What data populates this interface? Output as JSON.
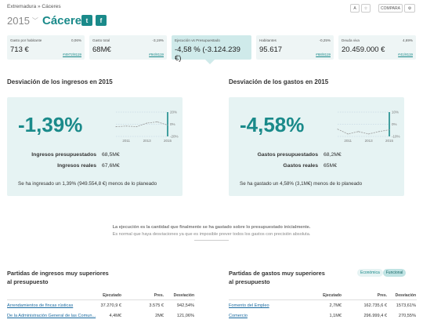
{
  "header": {
    "breadcrumb": "Extremadura » Cáceres",
    "year": "2015",
    "town": "Cáceres",
    "share_twitter": "t",
    "share_facebook": "f",
    "tool_text": "A",
    "tool_star": "☆",
    "compare_label": "COMPARA",
    "settings_icon": "⚙"
  },
  "kpis": [
    {
      "label": "Gasto por habitante",
      "pct": "0,06%",
      "value": "713 €",
      "rank": "#4972/8119"
    },
    {
      "label": "Gasto total",
      "pct": "-3,19%",
      "value": "68M€",
      "rank": "#94/8119"
    },
    {
      "label": "Ejecución vs Presupuestado",
      "pct": "",
      "value": "-4,58 % (-3.124.239 €)",
      "rank": ""
    },
    {
      "label": "Habitantes",
      "pct": "-0,25%",
      "value": "95.617",
      "rank": "#68/8119"
    },
    {
      "label": "Deuda viva",
      "pct": "4,69%",
      "value": "20.459.000 €",
      "rank": "#41/8119"
    }
  ],
  "income": {
    "section_title": "Desviación de los ingresos en 2015",
    "deviation": "-1,39%",
    "budgeted_label": "Ingresos presupuestados",
    "budgeted_value": "68,5M€",
    "real_label": "Ingresos reales",
    "real_value": "67,6M€",
    "note": "Se ha ingresado un 1,39% (949.554,8 €) menos de lo planeado",
    "spark": {
      "x": [
        2010,
        2011,
        2012,
        2013,
        2014,
        2015
      ],
      "y": [
        -4,
        -3,
        -4,
        2,
        4,
        -1.39
      ],
      "yticks": [
        "20%",
        "0%",
        "-20%"
      ],
      "xticks": [
        "2011",
        "2013",
        "2015"
      ]
    }
  },
  "spending": {
    "section_title": "Desviación de los gastos en 2015",
    "deviation": "-4,58%",
    "budgeted_label": "Gastos presupuestados",
    "budgeted_value": "68,2M€",
    "real_label": "Gastos reales",
    "real_value": "65M€",
    "note": "Se ha gastado un 4,58% (3,1M€) menos de lo planeado",
    "spark": {
      "x": [
        2010,
        2011,
        2012,
        2013,
        2014,
        2015
      ],
      "y": [
        -4,
        -8,
        -6,
        -8,
        -6,
        -4.58
      ],
      "yticks": [
        "10%",
        "0%",
        "-10%"
      ],
      "xticks": [
        "2011",
        "2013",
        "2015"
      ]
    }
  },
  "note": {
    "line1": "La ejecución es la cantidad que finalmente se ha gastado sobre lo presupuestado inicialmente.",
    "line2": "Es normal que haya desviaciones ya que es imposible prever todos los gastos con precisión absoluta."
  },
  "income_table": {
    "title_line1": "Partidas de ingresos muy superiores",
    "title_line2": "al presupuesto",
    "headers": [
      "Ejecutado",
      "Pres.",
      "Desviación"
    ],
    "rows": [
      {
        "name": "Arrendamientos de fincas rústicas",
        "executed": "37.270,9 €",
        "budget": "3.575 €",
        "deviation": "942,54%"
      },
      {
        "name": "De la Administración General de las Comun...",
        "executed": "4,4M€",
        "budget": "2M€",
        "deviation": "121,06%"
      }
    ]
  },
  "spending_table": {
    "title_line1": "Partidas de gastos muy superiores",
    "title_line2": "al presupuesto",
    "toggle_economic": "Económica",
    "toggle_functional": "Funcional",
    "headers": [
      "Ejecutado",
      "Pres.",
      "Desviación"
    ],
    "rows": [
      {
        "name": "Fomento del Empleo",
        "executed": "2,7M€",
        "budget": "162.735,6 €",
        "deviation": "1573,61%"
      },
      {
        "name": "Comercio",
        "executed": "1,1M€",
        "budget": "296.999,4 €",
        "deviation": "270,55%"
      }
    ]
  },
  "colors": {
    "accent": "#1a8a8a",
    "panel_bg": "#e6f3f3",
    "kpi_active": "#cfeaea"
  }
}
